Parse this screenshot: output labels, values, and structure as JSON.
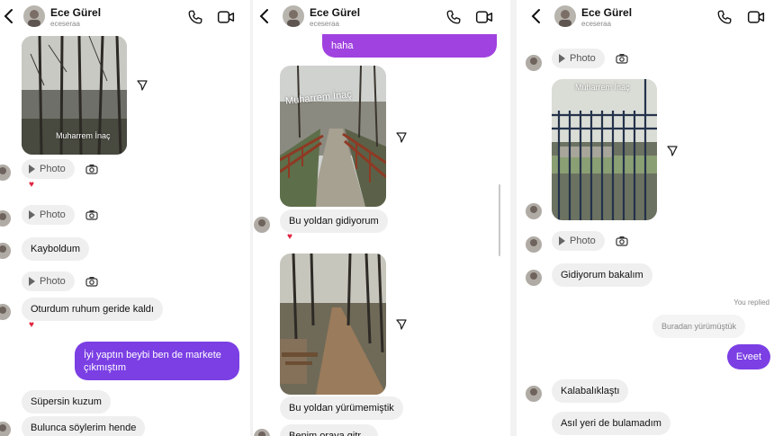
{
  "contact": {
    "name": "Ece Gürel",
    "username": "eceseraa"
  },
  "colors": {
    "sent": "#7b3fe4",
    "received": "#efefef",
    "heart": "#e0243f"
  },
  "icons": [
    "back-icon",
    "phone-icon",
    "video-call-icon",
    "share-icon",
    "camera-icon",
    "play-icon",
    "heart-icon"
  ],
  "panel1": {
    "image_caption": "Muharrem İnaç",
    "photo_label_1": "Photo",
    "photo_label_2": "Photo",
    "msg_kayboldum": "Kayboldum",
    "photo_label_3": "Photo",
    "msg_oturdum": "Oturdum ruhum geride kaldı",
    "msg_sent": "İyi yaptın beybi ben de markete çıkmıştım",
    "msg_supersin": "Süpersin kuzum",
    "msg_bulunca": "Bulunca söylerim hende"
  },
  "panel2": {
    "msg_haha": "haha",
    "image1_caption": "Muharrem İnaç",
    "msg_yoldan1": "Bu yoldan gidiyorum",
    "msg_yoldan2": "Bu yoldan yürümemiştik",
    "msg_partial": "Benim oraya gitr..."
  },
  "panel3": {
    "photo_label_top": "Photo",
    "image_caption": "Muharrem İnaç",
    "photo_label_2": "Photo",
    "msg_gidiyorum": "Gidiyorum bakalım",
    "replied_label": "You replied",
    "quoted_text": "Buradan yürümüştük",
    "msg_eveet": "Eveet",
    "msg_kalabalik": "Kalabalıklaştı",
    "msg_asil": "Asıl yeri de bulamadım"
  }
}
